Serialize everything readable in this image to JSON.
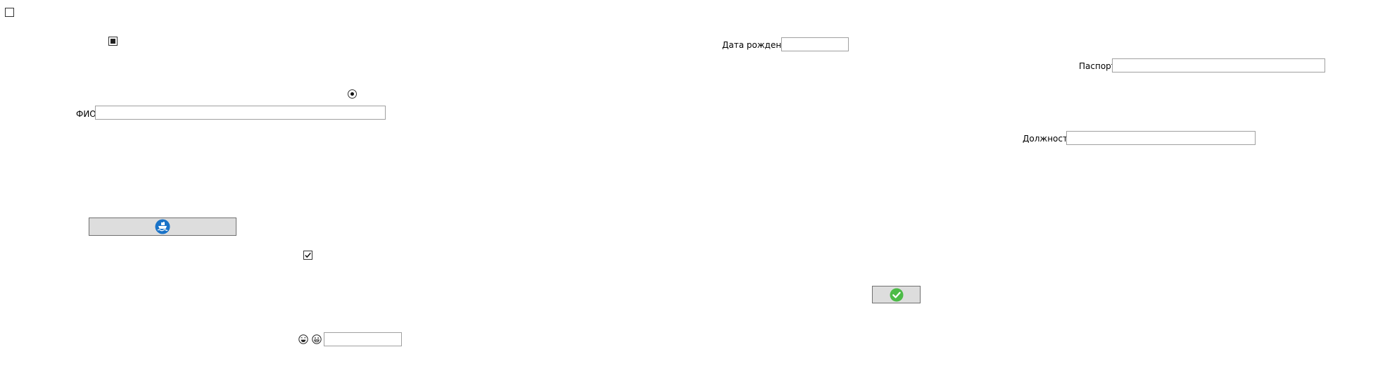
{
  "form": {
    "labels": {
      "fio": "ФИО",
      "birth_date": "Дата рождения",
      "passport": "Паспорт",
      "position": "Должность"
    },
    "fields": {
      "fio": {
        "value": "",
        "placeholder": ""
      },
      "birth_date": {
        "value": "",
        "placeholder": ""
      },
      "passport": {
        "value": "",
        "placeholder": ""
      },
      "position": {
        "value": "",
        "placeholder": ""
      },
      "small_input": {
        "value": "",
        "placeholder": ""
      }
    },
    "controls": {
      "top_checkbox_checked": false,
      "indeterminate_checkbox": "indeterminate",
      "radio_selected": true,
      "lower_checkbox_checked": true
    },
    "buttons": {
      "image_button_icon": "ship-icon",
      "confirm_button_icon": "checkmark-circle-icon"
    },
    "icons": {
      "emoji_left": "laughing-face-icon",
      "emoji_right": "grinning-face-icon"
    },
    "colors": {
      "ship_icon_bg": "#1a73c8",
      "confirm_icon_bg": "#4cbb47",
      "button_bg": "#dddddd",
      "field_border": "#a0a0a0"
    }
  }
}
